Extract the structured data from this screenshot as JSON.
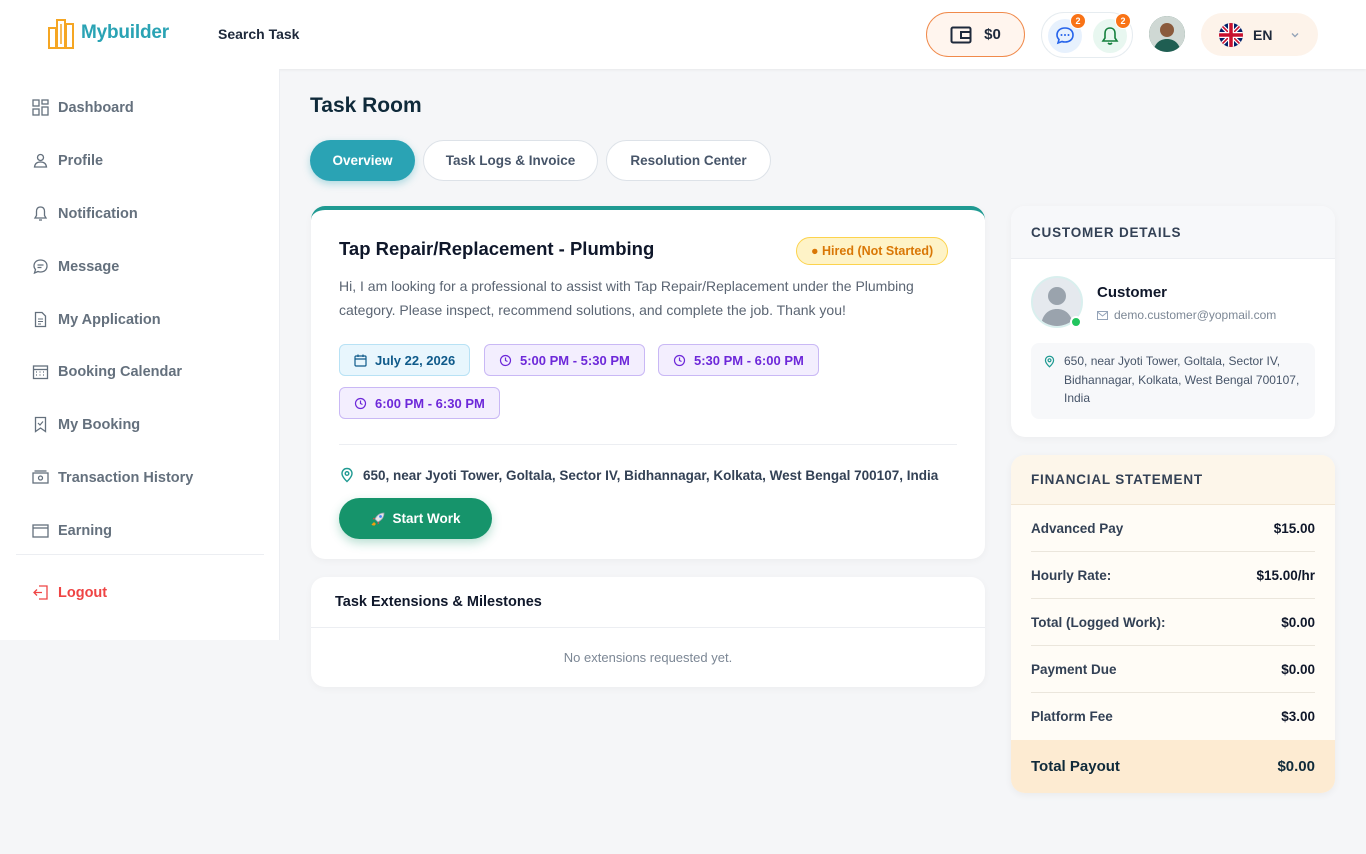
{
  "header": {
    "brand": "Mybuilder",
    "search_task": "Search Task",
    "wallet_amount": "$0",
    "messages_count": "2",
    "notifications_count": "2",
    "language": "EN"
  },
  "sidebar": {
    "items": [
      {
        "label": "Dashboard",
        "icon": "dashboard-icon"
      },
      {
        "label": "Profile",
        "icon": "user-icon"
      },
      {
        "label": "Notification",
        "icon": "bell-icon"
      },
      {
        "label": "Message",
        "icon": "chat-icon"
      },
      {
        "label": "My Application",
        "icon": "document-icon"
      },
      {
        "label": "Booking Calendar",
        "icon": "calendar-icon"
      },
      {
        "label": "My Booking",
        "icon": "bookmark-icon"
      },
      {
        "label": "Transaction History",
        "icon": "cash-icon"
      },
      {
        "label": "Earning",
        "icon": "earning-icon"
      }
    ],
    "logout": "Logout"
  },
  "page": {
    "title": "Task Room",
    "tabs": [
      "Overview",
      "Task Logs & Invoice",
      "Resolution Center"
    ],
    "active_tab": "Overview"
  },
  "task": {
    "title": "Tap Repair/Replacement - Plumbing",
    "status": "● Hired (Not Started)",
    "description": "Hi, I am looking for a professional to assist with Tap Repair/Replacement under the Plumbing category. Please inspect, recommend solutions, and complete the job. Thank you!",
    "date": "July 22, 2026",
    "slots": [
      "5:00 PM - 5:30 PM",
      "5:30 PM - 6:00 PM",
      "6:00 PM - 6:30 PM"
    ],
    "address": "650, near Jyoti Tower, Goltala, Sector IV, Bidhannagar, Kolkata, West Bengal 700107, India",
    "start_button": "Start Work"
  },
  "extensions": {
    "title": "Task Extensions & Milestones",
    "empty": "No extensions requested yet."
  },
  "customer": {
    "section_title": "CUSTOMER DETAILS",
    "name": "Customer",
    "email": "demo.customer@yopmail.com",
    "address": "650, near Jyoti Tower, Goltala, Sector IV, Bidhannagar, Kolkata, West Bengal 700107, India"
  },
  "financial": {
    "section_title": "FINANCIAL STATEMENT",
    "rows": [
      {
        "label": "Advanced Pay",
        "value": "$15.00"
      },
      {
        "label": "Hourly Rate:",
        "value": "$15.00/hr"
      },
      {
        "label": "Total (Logged Work):",
        "value": "$0.00"
      },
      {
        "label": "Payment Due",
        "value": "$0.00"
      },
      {
        "label": "Platform Fee",
        "value": "$3.00"
      }
    ],
    "total_label": "Total Payout",
    "total_value": "$0.00"
  },
  "colors": {
    "brand": "#2aa3b4",
    "accent_orange": "#f08a4b",
    "success": "#16946b",
    "danger": "#ef4444"
  }
}
